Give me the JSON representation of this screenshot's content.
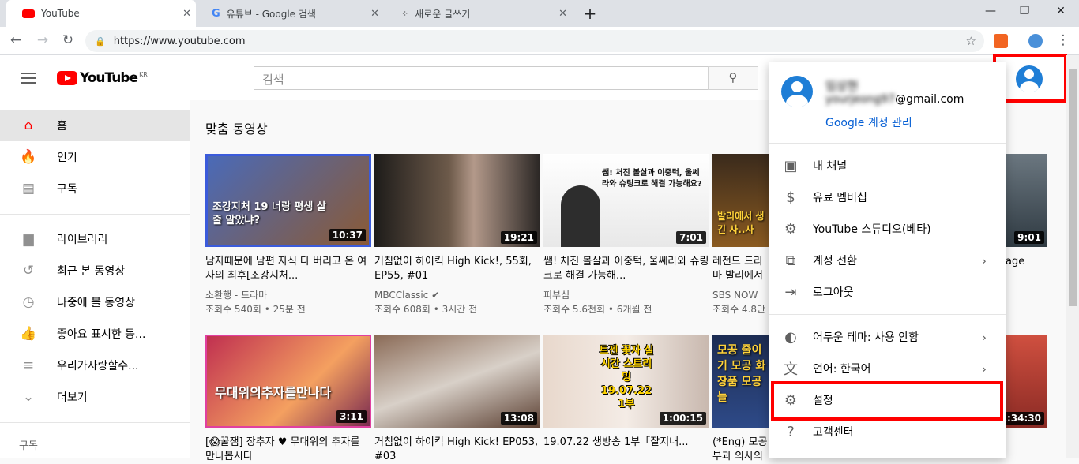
{
  "browser": {
    "tabs": [
      {
        "title": "YouTube",
        "favicon_color": "#ff0000"
      },
      {
        "title": "유튜브 - Google 검색",
        "favicon_color": "#4285f4"
      },
      {
        "title": "새로운 글쓰기",
        "favicon_color": "#333333"
      }
    ],
    "new_tab": "+",
    "url": "https://www.youtube.com",
    "window_controls": [
      "—",
      "❐",
      "✕"
    ]
  },
  "youtube": {
    "logo_word": "YouTube",
    "logo_region": "KR",
    "search_placeholder": "검색",
    "sidebar": {
      "items": [
        {
          "label": "홈",
          "icon": "⌂"
        },
        {
          "label": "인기",
          "icon": "🔥"
        },
        {
          "label": "구독",
          "icon": "▤"
        },
        {
          "label": "라이브러리",
          "icon": "▆"
        },
        {
          "label": "최근 본 동영상",
          "icon": "↺"
        },
        {
          "label": "나중에 볼 동영상",
          "icon": "◷"
        },
        {
          "label": "좋아요 표시한 동...",
          "icon": "👍"
        },
        {
          "label": "우리가사랑할수...",
          "icon": "≡"
        },
        {
          "label": "더보기",
          "icon": "⌄"
        }
      ],
      "subscriptions_heading": "구독"
    },
    "section_title": "맞춤 동영상",
    "videos_row1": [
      {
        "title": "남자때문에 남편 자식 다 버리고 온 여자의 최후[조강지처...",
        "channel": "소환행 - 드라마",
        "meta": "조회수 540회 • 25분 전",
        "duration": "10:37",
        "caption": "조강지처 19 너랑 평생 살 줄 알았냐?",
        "bg": "#6b4a2a"
      },
      {
        "title": "거침없이 하이킥 High Kick!, 55회, EP55, #01",
        "channel": "MBCClassic",
        "meta": "조회수 608회 • 3시간 전",
        "duration": "19:21",
        "caption": "",
        "bg": "#2b2622"
      },
      {
        "title": "쌤! 처진 볼살과 이중턱, 울쎄라와 슈링크로 해결 가능해...",
        "channel": "피부심",
        "meta": "조회수 5.6천회 • 6개월 전",
        "duration": "7:01",
        "caption": "쌤! 처진 볼살과 이중턱, 울쎄라와 슈링크로 해결 가능해요?",
        "bg": "#f2f2f2"
      },
      {
        "title": "레전드 드라마 발리에서 생긴 일] Ep.마지막",
        "channel": "SBS NOW",
        "meta": "조회수 4.8만",
        "duration": "",
        "caption": "발리에서 생긴 사..사",
        "bg": "#5a3e26"
      },
      {
        "title": "age",
        "channel": "",
        "meta": "",
        "duration": "9:01",
        "caption": "",
        "bg": "#3f4a52"
      }
    ],
    "videos_row2": [
      {
        "title": "[😱꿀잼] 장추자 ♥ 무대위의 추자를 만나봅시다",
        "channel": "",
        "meta": "",
        "duration": "3:11",
        "caption": "무대위의추자를만나다",
        "bg": "#b8324f"
      },
      {
        "title": "거침없이 하이킥 High Kick! EP053, #03",
        "channel": "",
        "meta": "",
        "duration": "13:08",
        "caption": "",
        "bg": "#6a4a3a"
      },
      {
        "title": "19.07.22 생방송 1부「잘지내...",
        "channel": "",
        "meta": "",
        "duration": "1:00:15",
        "caption": "트젠 꽃자 실시간 스트리밍 19.07.22 1부",
        "bg": "#d9c9c0"
      },
      {
        "title": "(*Eng) 모공 부과 의사의",
        "channel": "",
        "meta": "",
        "duration": "",
        "caption": "모공 줄이기 모공 화장품 모공 늘",
        "bg": "#223a66"
      },
      {
        "title": "",
        "channel": "",
        "meta": "",
        "duration": "1:34:30",
        "caption": "",
        "bg": "#c0453a"
      }
    ],
    "account_menu": {
      "name": "임상현",
      "email_hidden": "yourjeong97",
      "email_domain": "@gmail.com",
      "manage_label": "Google 계정 관리",
      "items": [
        {
          "label": "내 채널",
          "icon": "▣",
          "chevron": false
        },
        {
          "label": "유료 멤버십",
          "icon": "$",
          "chevron": false
        },
        {
          "label": "YouTube 스튜디오(베타)",
          "icon": "⚙",
          "chevron": false
        },
        {
          "label": "계정 전환",
          "icon": "⧉",
          "chevron": true
        },
        {
          "label": "로그아웃",
          "icon": "⇥",
          "chevron": false
        },
        {
          "label": "어두운 테마: 사용 안함",
          "icon": "◐",
          "chevron": true
        },
        {
          "label": "언어: 한국어",
          "icon": "文",
          "chevron": true
        },
        {
          "label": "설정",
          "icon": "⚙",
          "chevron": false
        },
        {
          "label": "고객센터",
          "icon": "?",
          "chevron": false
        }
      ],
      "chevron_glyph": "›"
    }
  }
}
